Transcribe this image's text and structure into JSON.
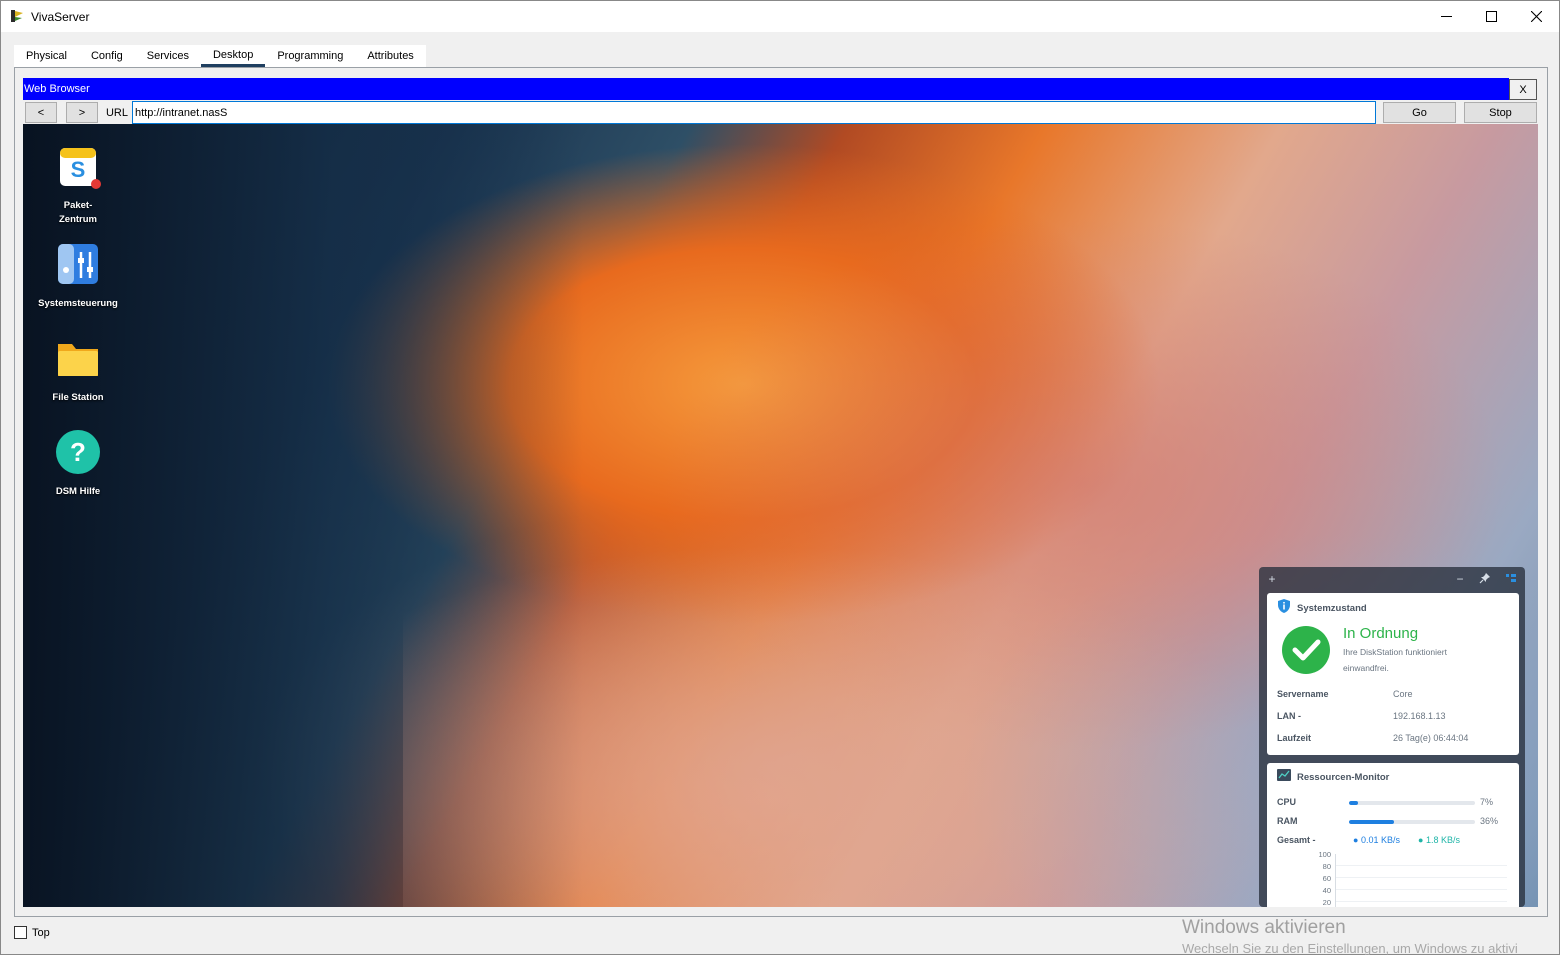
{
  "window": {
    "title": "VivaServer",
    "minimize_glyph": "minimize-icon",
    "maximize_glyph": "maximize-icon",
    "close_glyph": "close-icon"
  },
  "tabs": [
    {
      "label": "Physical",
      "active": false
    },
    {
      "label": "Config",
      "active": false
    },
    {
      "label": "Services",
      "active": false
    },
    {
      "label": "Desktop",
      "active": true
    },
    {
      "label": "Programming",
      "active": false
    },
    {
      "label": "Attributes",
      "active": false
    }
  ],
  "browser": {
    "title": "Web Browser",
    "close_label": "X",
    "back_label": "<",
    "forward_label": ">",
    "url_label": "URL",
    "url_value": "http://intranet.nasS",
    "go_label": "Go",
    "stop_label": "Stop"
  },
  "desktop": {
    "icons": [
      {
        "label_1": "Paket-",
        "label_2": "Zentrum",
        "icon": "package-center-icon"
      },
      {
        "label_1": "Systemsteuerung",
        "icon": "control-panel-icon"
      },
      {
        "label_1": "File Station",
        "icon": "folder-icon"
      },
      {
        "label_1": "DSM Hilfe",
        "icon": "help-icon"
      }
    ]
  },
  "widgets": {
    "system_status": {
      "title": "Systemzustand",
      "status": "In Ordnung",
      "message_1": "Ihre DiskStation funktioniert",
      "message_2": "einwandfrei.",
      "servername_key": "Servername",
      "servername_value": "Core",
      "lan_key": "LAN -",
      "lan_value": "192.168.1.13",
      "uptime_key": "Laufzeit",
      "uptime_value": "26 Tag(e) 06:44:04",
      "status_color": "#2db34a"
    },
    "resource_monitor": {
      "title": "Ressourcen-Monitor",
      "cpu_key": "CPU",
      "cpu_value": "7%",
      "cpu_percent": 7,
      "ram_key": "RAM",
      "ram_value": "36%",
      "ram_percent": 36,
      "total_key": "Gesamt -",
      "upload": "0.01 KB/s",
      "download": "1.8 KB/s",
      "axis": [
        "100",
        "80",
        "60",
        "40",
        "20"
      ],
      "upload_color": "#1e7fe0",
      "download_color": "#1fb5a8"
    }
  },
  "footer": {
    "top_label": "Top",
    "top_checked": false,
    "watermark_title": "Windows aktivieren",
    "watermark_sub": "Wechseln Sie zu den Einstellungen, um Windows zu aktivi"
  }
}
